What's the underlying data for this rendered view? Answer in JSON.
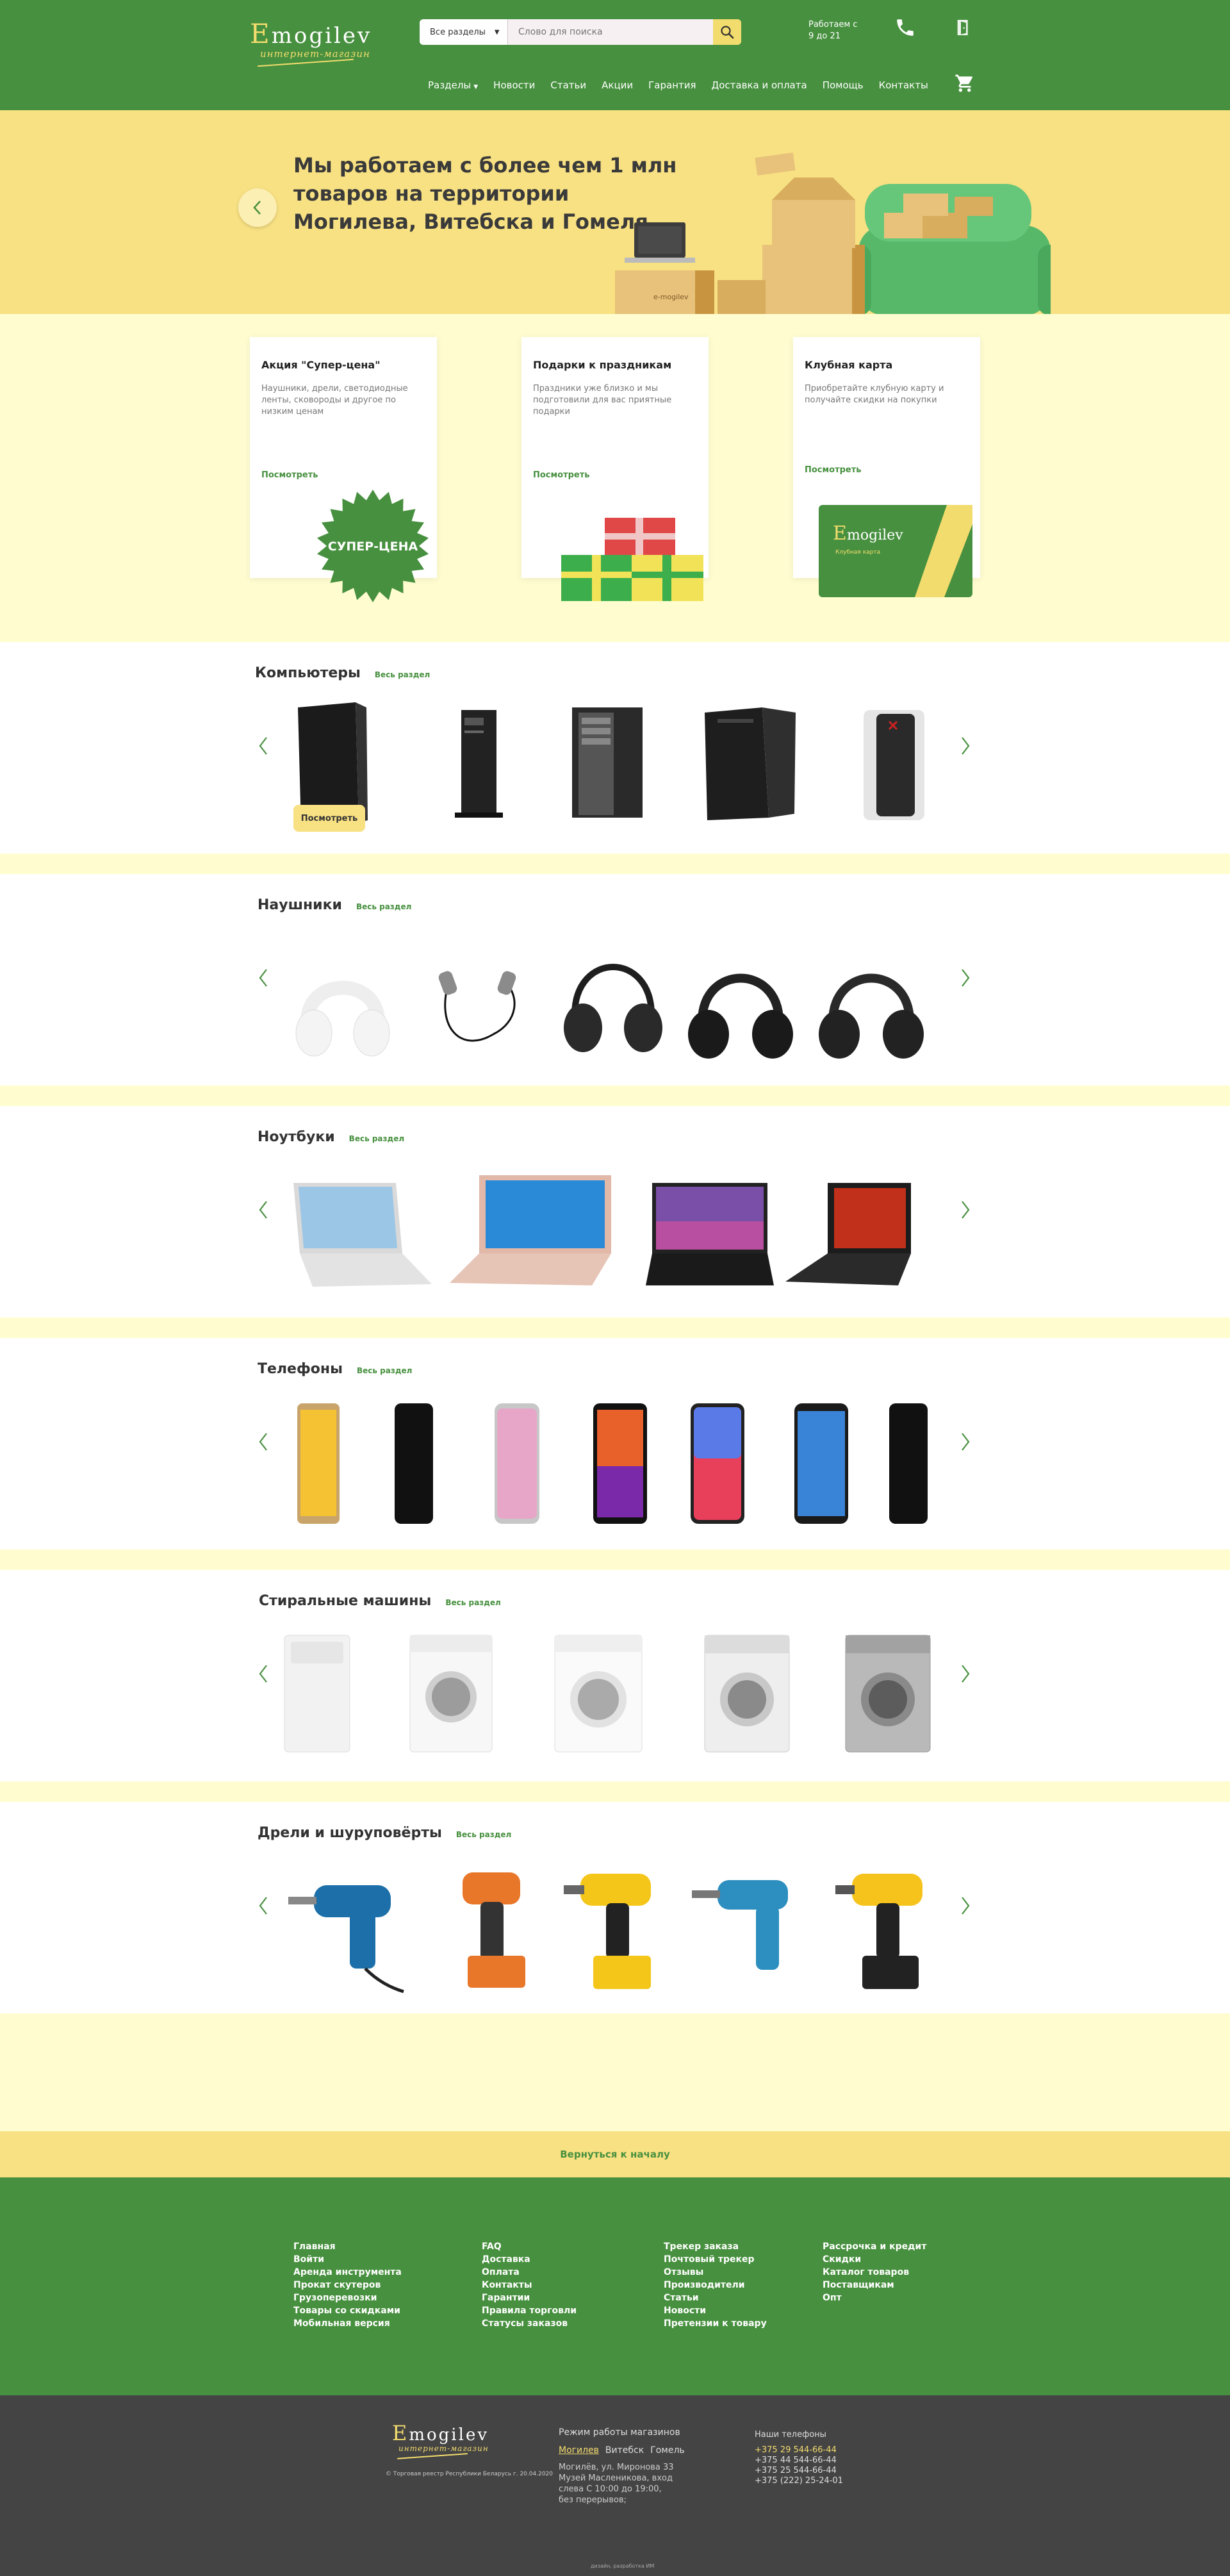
{
  "header": {
    "logo_e": "E",
    "logo_rest": "mogilev",
    "logo_sub": "интернет-магазин",
    "search_category": "Все разделы",
    "search_placeholder": "Слово для поиска",
    "hours_line1": "Работаем с",
    "hours_line2": "9 до 21",
    "nav": [
      "Разделы",
      "Новости",
      "Статьи",
      "Акции",
      "Гарантия",
      "Доставка и оплата",
      "Помощь",
      "Контакты"
    ]
  },
  "hero": {
    "text": "Мы работаем  с более чем 1 млн товаров на территории Могилева, Витебска и Гомеля",
    "box_label": "e-mogilev"
  },
  "promos": [
    {
      "title": "Акция \"Супер-цена\"",
      "text": "Наушники, дрели, светодиодные ленты, сковороды и другое по низким ценам",
      "link": "Посмотреть",
      "badge": "СУПЕР-ЦЕНА"
    },
    {
      "title": "Подарки к праздникам",
      "text": "Праздники уже близко и мы подготовили для вас приятные подарки",
      "link": "Посмотреть"
    },
    {
      "title": "Клубная карта",
      "text": "Приобретайте клубную карту и получайте скидки на покупки",
      "link": "Посмотреть",
      "card_e": "E",
      "card_rest": "mogilev",
      "card_sub": "Клубная карта"
    }
  ],
  "sections": [
    {
      "title": "Компьютеры",
      "link": "Весь раздел",
      "view_label": "Посмотреть"
    },
    {
      "title": "Наушники",
      "link": "Весь раздел"
    },
    {
      "title": "Ноутбуки",
      "link": "Весь раздел"
    },
    {
      "title": "Телефоны",
      "link": "Весь раздел"
    },
    {
      "title": "Стиральные машины",
      "link": "Весь раздел"
    },
    {
      "title": "Дрели и шуруповёрты",
      "link": "Весь раздел"
    }
  ],
  "footer": {
    "back_to_top": "Вернуться к началу",
    "col1": [
      "Главная",
      "Войти",
      "Аренда инструмента",
      "Прокат скутеров",
      "Грузоперевозки",
      "Товары со скидками",
      "Мобильная версия"
    ],
    "col2": [
      "FAQ",
      "Доставка",
      "Оплата",
      "Контакты",
      "Гарантии",
      "Правила торговли",
      "Статусы заказов"
    ],
    "col3": [
      "Трекер заказа",
      "Почтовый трекер",
      "Отзывы",
      "Производители",
      "Статьи",
      "Новости",
      "Претензии к товару"
    ],
    "col4": [
      "Рассрочка и кредит",
      "Скидки",
      "Каталог товаров",
      "Поставщикам",
      "Опт"
    ],
    "copyright": "© Торговая реестр Республики Беларусь г. 20.04.2020",
    "hours_title": "Режим работы магазинов",
    "cities": [
      "Могилев",
      "Витебск",
      "Гомель"
    ],
    "address": "Могилёв, ул. Миронова 33 Музей Масленикова, вход слева С 10:00 до 19:00, без перерывов;",
    "phones_title": "Наши телефоны",
    "phones": [
      "+375 29 544-66-44",
      "+375 44 544-66-44",
      "+375 25 544-66-44",
      "+375 (222) 25-24-01"
    ],
    "design": "дизайн, разработка ИМ"
  },
  "colors": {
    "green": "#47903f",
    "yellow": "#f8e183",
    "cream": "#fffdd0",
    "dark": "#444444"
  }
}
